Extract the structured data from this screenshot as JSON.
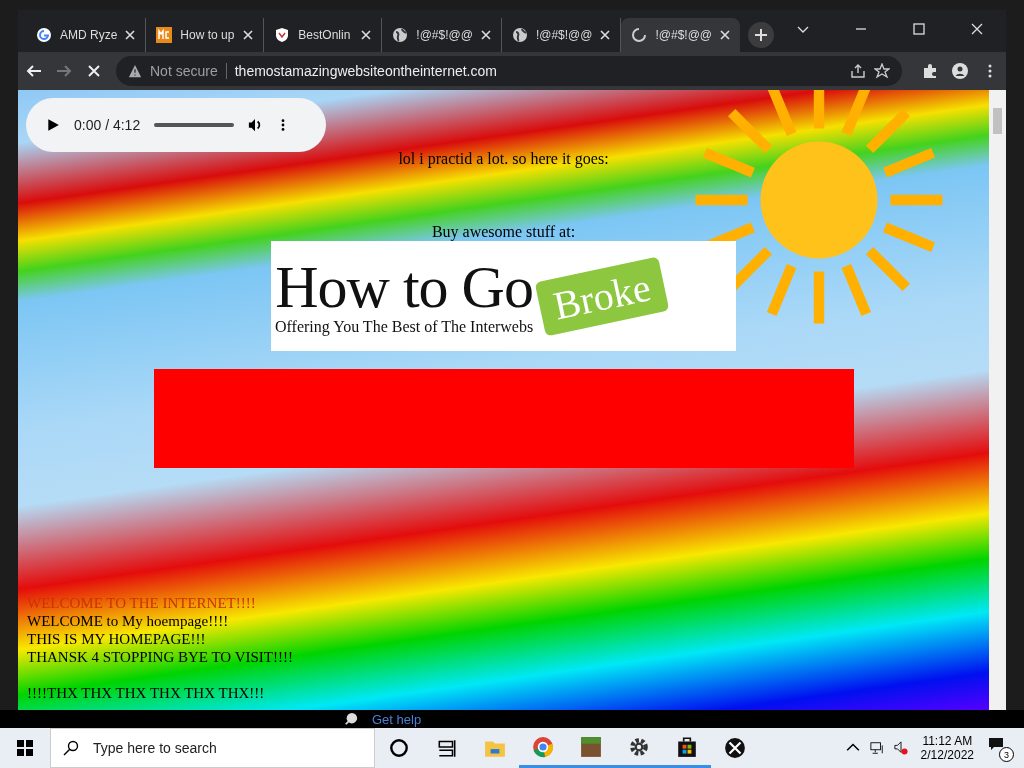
{
  "tabs": [
    {
      "title": "AMD Ryze",
      "kind": "google",
      "selected": false
    },
    {
      "title": "How to up",
      "kind": "mc",
      "selected": false
    },
    {
      "title": "BestOnlin",
      "kind": "shield",
      "selected": false
    },
    {
      "title": "!@#$!@@",
      "kind": "globe",
      "selected": false
    },
    {
      "title": "!@#$!@@",
      "kind": "globe",
      "selected": false
    },
    {
      "title": "!@#$!@@",
      "kind": "loading",
      "selected": true
    }
  ],
  "address_bar": {
    "security": "Not secure",
    "url": "themostamazingwebsiteontheinternet.com"
  },
  "audio_player": {
    "time": "0:00 / 4:12",
    "level": 0
  },
  "page": {
    "intro": "lol i practid a lot. so here it goes:",
    "buy_text": "Buy awesome stuff at:",
    "logo": {
      "title": "How to Go",
      "tag": "Broke",
      "tagline": "Offering You The Best of The Interwebs"
    },
    "lines": [
      {
        "text": "WELCOME TO THE INTERNET!!!!",
        "color": "#cc3300"
      },
      {
        "text": "WELCOME to My hoempage!!!!",
        "color": "#000000"
      },
      {
        "text": "THIS IS MY HOMEPAGE!!!",
        "color": "#000000"
      },
      {
        "text": "THANSK 4 STOPPING BYE TO VISIT!!!!",
        "color": "#000000"
      },
      {
        "text": "!!!!THX THX THX THX THX THX!!!",
        "color": "#000000"
      }
    ]
  },
  "help_link": "Get help",
  "taskbar": {
    "search_placeholder": "Type here to search",
    "apps": [
      {
        "kind": "cortana",
        "running": false
      },
      {
        "kind": "taskview",
        "running": false
      },
      {
        "kind": "explorer",
        "running": false
      },
      {
        "kind": "chrome",
        "running": true
      },
      {
        "kind": "minecraft",
        "running": true
      },
      {
        "kind": "settings",
        "running": true
      },
      {
        "kind": "store",
        "running": true
      },
      {
        "kind": "xbox",
        "running": false
      }
    ],
    "time": "11:12 AM",
    "date": "2/12/2022",
    "notifications": "3"
  }
}
